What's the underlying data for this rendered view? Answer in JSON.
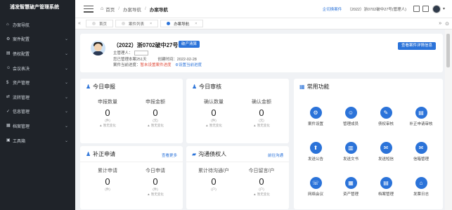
{
  "sidebar": {
    "logo": "浦发智慧破产管理系统",
    "items": [
      {
        "label": "办案导航",
        "icon": "home-icon",
        "glyph": "⌂",
        "chev": ""
      },
      {
        "label": "案件配置",
        "icon": "gear-icon",
        "glyph": "⚙",
        "chev": "⌄"
      },
      {
        "label": "债权配置",
        "icon": "file-icon",
        "glyph": "▤",
        "chev": "⌄"
      },
      {
        "label": "会议表决",
        "icon": "people-icon",
        "glyph": "☺",
        "chev": "⌄"
      },
      {
        "label": "资产管理",
        "icon": "money-icon",
        "glyph": "$",
        "chev": "⌄"
      },
      {
        "label": "流转管理",
        "icon": "flow-icon",
        "glyph": "⇄",
        "chev": "⌄"
      },
      {
        "label": "信息管理",
        "icon": "check-icon",
        "glyph": "✓",
        "chev": "⌄"
      },
      {
        "label": "档案管理",
        "icon": "archive-icon",
        "glyph": "▦",
        "chev": "⌄"
      },
      {
        "label": "工具箱",
        "icon": "toolbox-icon",
        "glyph": "▣",
        "chev": "⌄"
      }
    ]
  },
  "header": {
    "breadcrumb": [
      "首页",
      "办案导航",
      "办案导航"
    ],
    "switch_case": "企切换案件",
    "user_info": "（2022）浙0702破中27号(管理人)"
  },
  "tabs": [
    {
      "label": "首页",
      "active": false
    },
    {
      "label": "案件列表",
      "active": false
    },
    {
      "label": "办案导航",
      "active": true
    }
  ],
  "case": {
    "title": "（2022）浙0702破中27号",
    "badge": "破产清算",
    "manager_label": "主管理人：",
    "days_label": "您已管理本案251天",
    "date_label": "创建时间：2022-02-28",
    "progress_label": "案件当前进度：",
    "progress_value": "暂未设置案件进度",
    "progress_link": "⚙设置当前进度",
    "detail_button": "查看案件详情信息"
  },
  "panels": {
    "today_report": {
      "title": "今日申报",
      "stats": [
        {
          "label": "申报数量",
          "value": "0",
          "unit": "(件)",
          "trend": "▲ 暂无变化"
        },
        {
          "label": "申报金额",
          "value": "0",
          "unit": "(元)",
          "trend": "▲ 暂无变化"
        }
      ]
    },
    "today_review": {
      "title": "今日审核",
      "stats": [
        {
          "label": "确认数量",
          "value": "0",
          "unit": "(件)",
          "trend": "▲ 暂无变化"
        },
        {
          "label": "确认金额",
          "value": "0",
          "unit": "(元)",
          "trend": "▲ 暂无变化"
        }
      ]
    },
    "supplement": {
      "title": "补正申请",
      "link": "查看更多",
      "stats": [
        {
          "label": "累计申请",
          "value": "0",
          "unit": "(件)",
          "trend": ""
        },
        {
          "label": "今日申请",
          "value": "0",
          "unit": "(件)",
          "trend": "▲ 暂无变化"
        }
      ]
    },
    "communicate": {
      "title": "沟通债权人",
      "link": "前往沟通",
      "stats": [
        {
          "label": "累计待沟通/户",
          "value": "0",
          "unit": "(户)",
          "trend": ""
        },
        {
          "label": "今日留言/户",
          "value": "0",
          "unit": "(户)",
          "trend": "▲ 暂无变化"
        }
      ]
    },
    "common": {
      "title": "常用功能",
      "items": [
        {
          "label": "案件设置",
          "icon": "settings-icon",
          "glyph": "⚙"
        },
        {
          "label": "管理成员",
          "icon": "members-icon",
          "glyph": "☺"
        },
        {
          "label": "债权审核",
          "icon": "audit-icon",
          "glyph": "✎"
        },
        {
          "label": "补正申请审核",
          "icon": "review-icon",
          "glyph": "▤"
        },
        {
          "label": "发送公告",
          "icon": "announce-icon",
          "glyph": "⬆"
        },
        {
          "label": "发送文书",
          "icon": "document-icon",
          "glyph": "▥"
        },
        {
          "label": "发送短信",
          "icon": "sms-icon",
          "glyph": "✉"
        },
        {
          "label": "信箱管理",
          "icon": "mailbox-icon",
          "glyph": "✉"
        },
        {
          "label": "网络会议",
          "icon": "meeting-icon",
          "glyph": "☏"
        },
        {
          "label": "资产管理",
          "icon": "asset-icon",
          "glyph": "▦"
        },
        {
          "label": "档案管理",
          "icon": "archive-icon",
          "glyph": "▤"
        },
        {
          "label": "发票日志",
          "icon": "invoice-icon",
          "glyph": "⌂"
        }
      ]
    }
  },
  "colors": {
    "accent": "#2b73d9",
    "sidebar": "#1f2329",
    "warn": "#e04b3a"
  }
}
